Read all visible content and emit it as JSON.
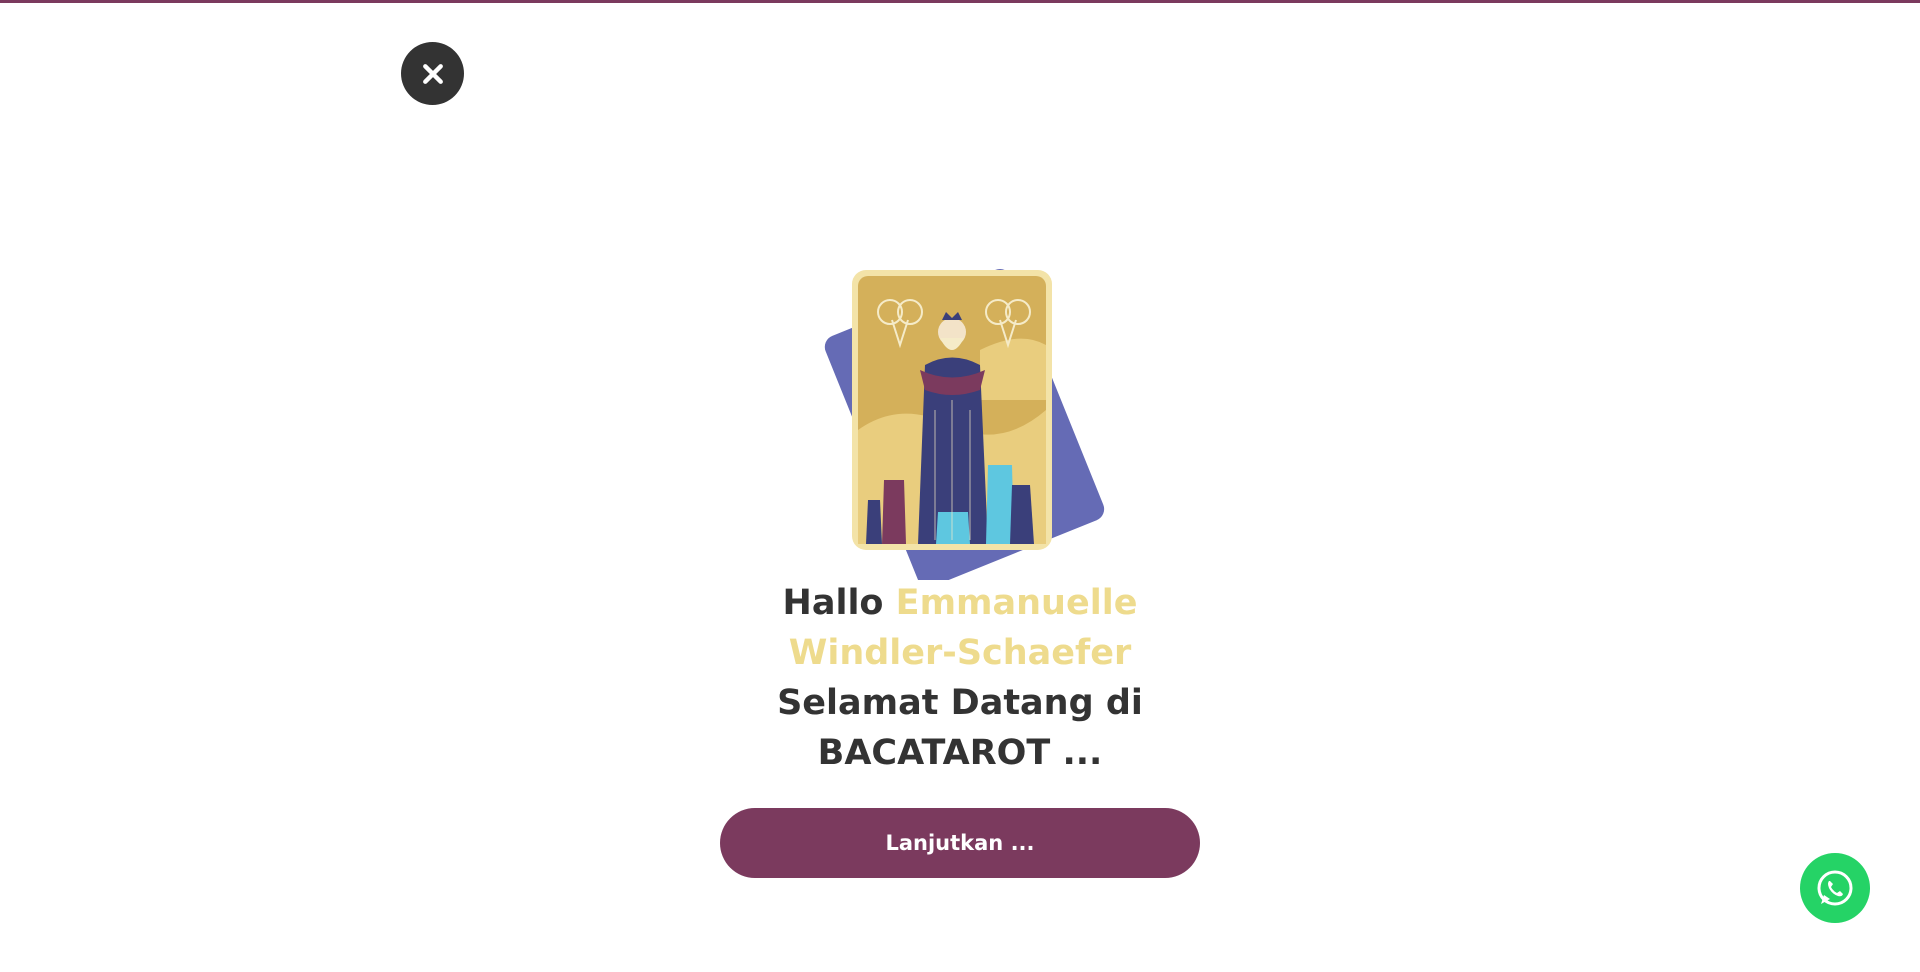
{
  "colors": {
    "accent": "#7b3a5e",
    "name_highlight": "#eedb8d",
    "text": "#333333",
    "close_button": "#333333",
    "whatsapp": "#25d366",
    "card_back": "#656bb5",
    "card_face": "#d4b05a"
  },
  "close_button": {
    "icon": "close-icon"
  },
  "card": {
    "icon": "tarot-card-emperor-icon"
  },
  "greeting": {
    "prefix": "Hallo",
    "name": "Emmanuelle Windler-Schaefer"
  },
  "welcome": {
    "line1": "Selamat Datang di",
    "line2": "BACATAROT ..."
  },
  "continue_button": {
    "label": "Lanjutkan ..."
  },
  "whatsapp_button": {
    "icon": "whatsapp-icon"
  }
}
